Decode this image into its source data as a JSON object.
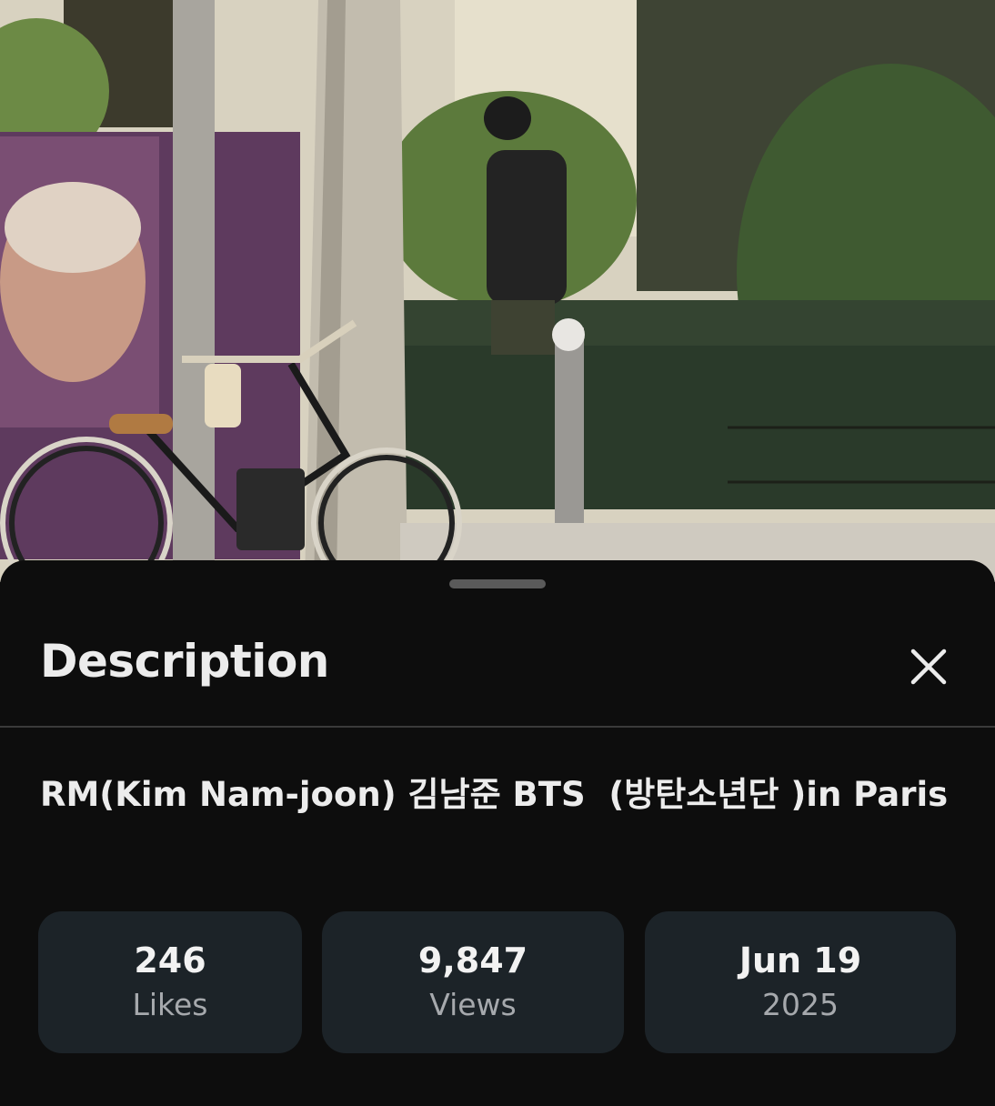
{
  "sheet": {
    "title": "Description",
    "close_icon": "close-icon",
    "video_title": "RM(Kim Nam-joon) 김남준 BTS  (방탄소년단 )in Paris"
  },
  "stats": [
    {
      "value": "246",
      "label": "Likes"
    },
    {
      "value": "9,847",
      "label": "Views"
    },
    {
      "value": "Jun 19",
      "label": "2025"
    }
  ],
  "colors": {
    "sheet_background": "#0d0d0d",
    "card_background": "#1c2328",
    "primary_text": "#ececec",
    "secondary_text": "#a6a9ad"
  }
}
